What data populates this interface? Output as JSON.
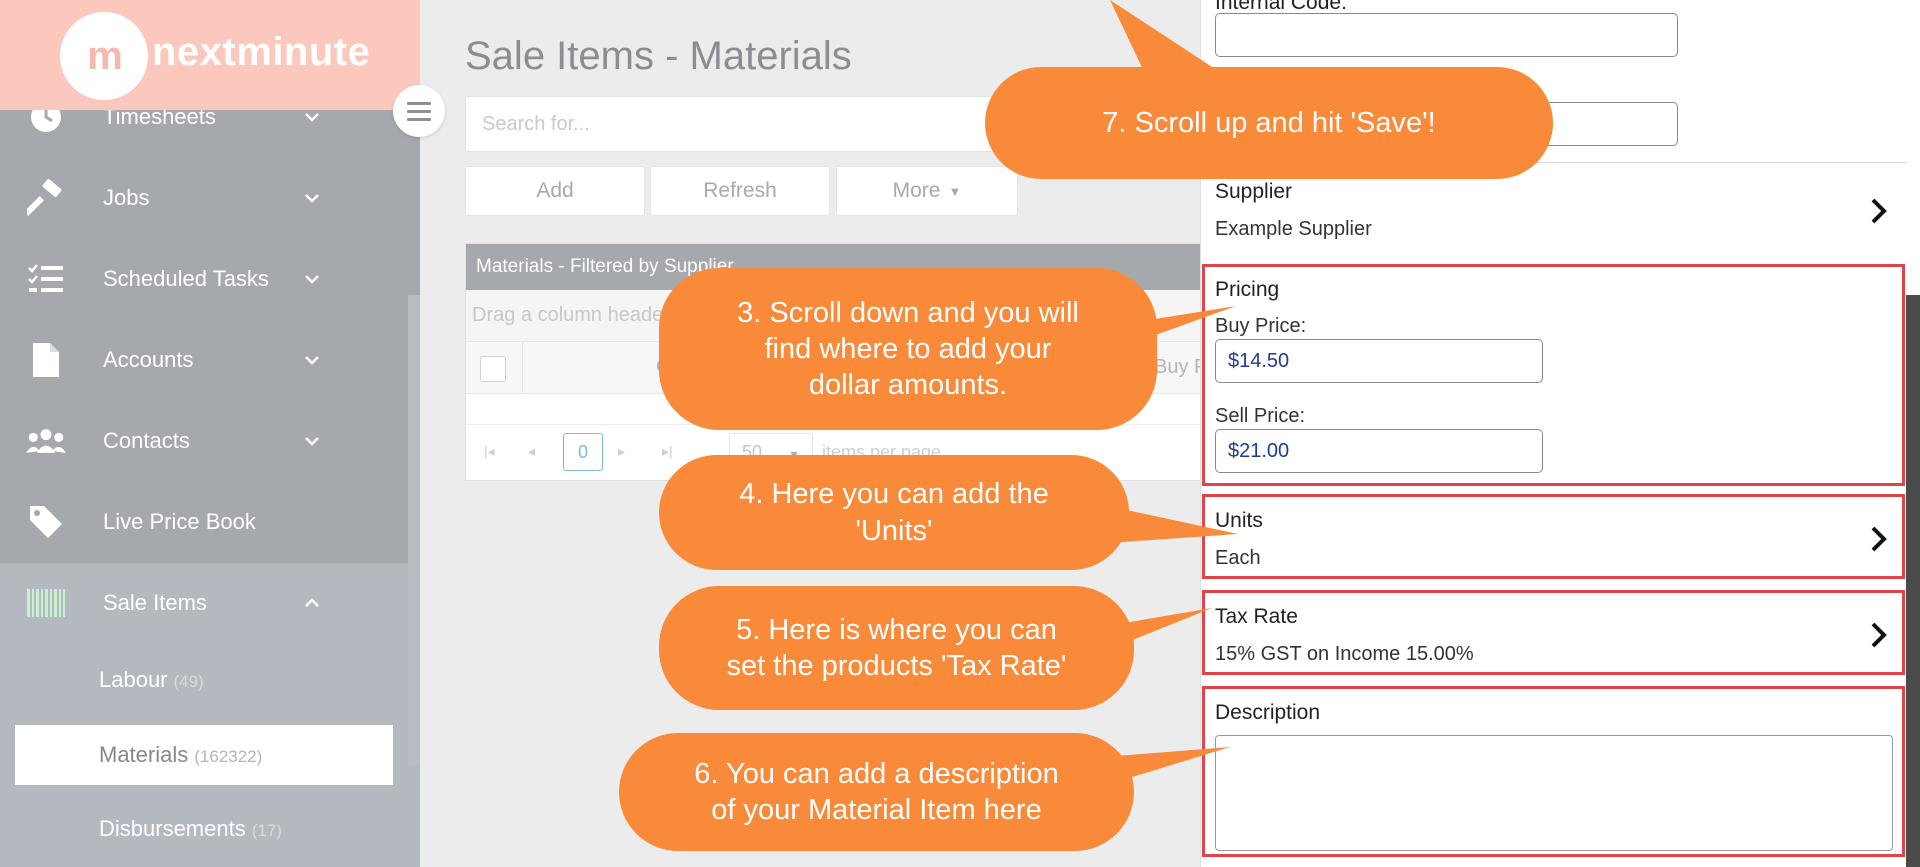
{
  "logo": {
    "mark": "m",
    "text": "nextminute"
  },
  "sidebar": {
    "items": [
      {
        "label": "Timesheets",
        "icon": "clock-icon"
      },
      {
        "label": "Jobs",
        "icon": "hammer-icon"
      },
      {
        "label": "Scheduled Tasks",
        "icon": "checklist-icon"
      },
      {
        "label": "Accounts",
        "icon": "document-icon"
      },
      {
        "label": "Contacts",
        "icon": "people-icon"
      },
      {
        "label": "Live Price Book",
        "icon": "tag-icon"
      },
      {
        "label": "Sale Items",
        "icon": "barcode-icon"
      }
    ],
    "sub_items": [
      {
        "label": "Labour",
        "count": "(49)"
      },
      {
        "label": "Materials",
        "count": "(162322)"
      },
      {
        "label": "Disbursements",
        "count": "(17)"
      }
    ]
  },
  "main": {
    "title": "Sale Items - Materials",
    "search_placeholder": "Search for...",
    "buttons": {
      "add": "Add",
      "refresh": "Refresh",
      "more": "More"
    },
    "grid": {
      "header": "Materials - Filtered by Supplier",
      "group_hint": "Drag a column header",
      "col_c": "C",
      "col_buy": "Buy P",
      "pager": {
        "current": "0",
        "page_size": "50",
        "label": "items per page"
      }
    }
  },
  "panel": {
    "internal_code_label": "Internal Code:",
    "supplier_label": "Supplier",
    "supplier_value": "Example Supplier",
    "pricing_label": "Pricing",
    "buy_price_label": "Buy Price:",
    "buy_price_value": "$14.50",
    "sell_price_label": "Sell Price:",
    "sell_price_value": "$21.00",
    "units_label": "Units",
    "units_value": "Each",
    "tax_label": "Tax Rate",
    "tax_value": "15% GST on Income 15.00%",
    "description_label": "Description"
  },
  "callouts": {
    "c7": "7. Scroll up and hit 'Save'!",
    "c3": [
      "3. Scroll down and you will",
      "find where to add your",
      "dollar amounts."
    ],
    "c4": [
      "4. Here you can add the",
      "'Units'"
    ],
    "c5": [
      "5. Here is where you can",
      "set the products 'Tax Rate'"
    ],
    "c6": [
      "6. You can add a description",
      "of your Material Item here"
    ]
  },
  "colors": {
    "callout": "#f98a3a",
    "highlight": "#e0444b",
    "sidebar": "#a5a8ad",
    "logo_bg": "#fcc8bd"
  }
}
